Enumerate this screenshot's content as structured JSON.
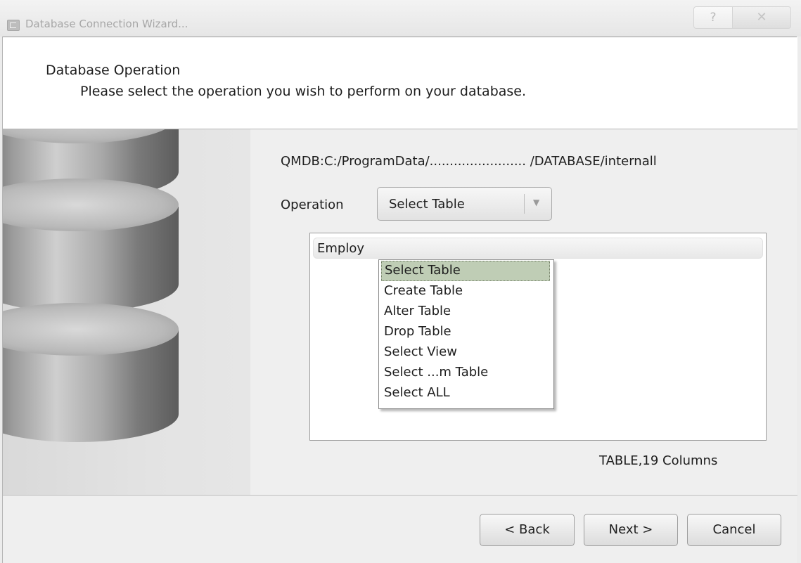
{
  "window": {
    "title": "Database Connection Wizard...",
    "help_label": "?",
    "close_label": "✕"
  },
  "header": {
    "title": "Database Operation",
    "subtitle": "Please select the operation you wish to perform on your database."
  },
  "connection": {
    "path": "QMDB:C:/ProgramData/........................ /DATABASE/internall"
  },
  "operation": {
    "label": "Operation",
    "selected": "Select Table",
    "arrow_icon": "chevron-down-icon",
    "options": [
      "Select Table",
      "Create Table",
      "Alter Table",
      "Drop Table",
      "Select View",
      "Select ...m Table",
      "Select ALL"
    ]
  },
  "table_list": {
    "first_item": "Employ",
    "info": "TABLE,19 Columns"
  },
  "buttons": {
    "back": "< Back",
    "next": "Next >",
    "cancel": "Cancel"
  }
}
